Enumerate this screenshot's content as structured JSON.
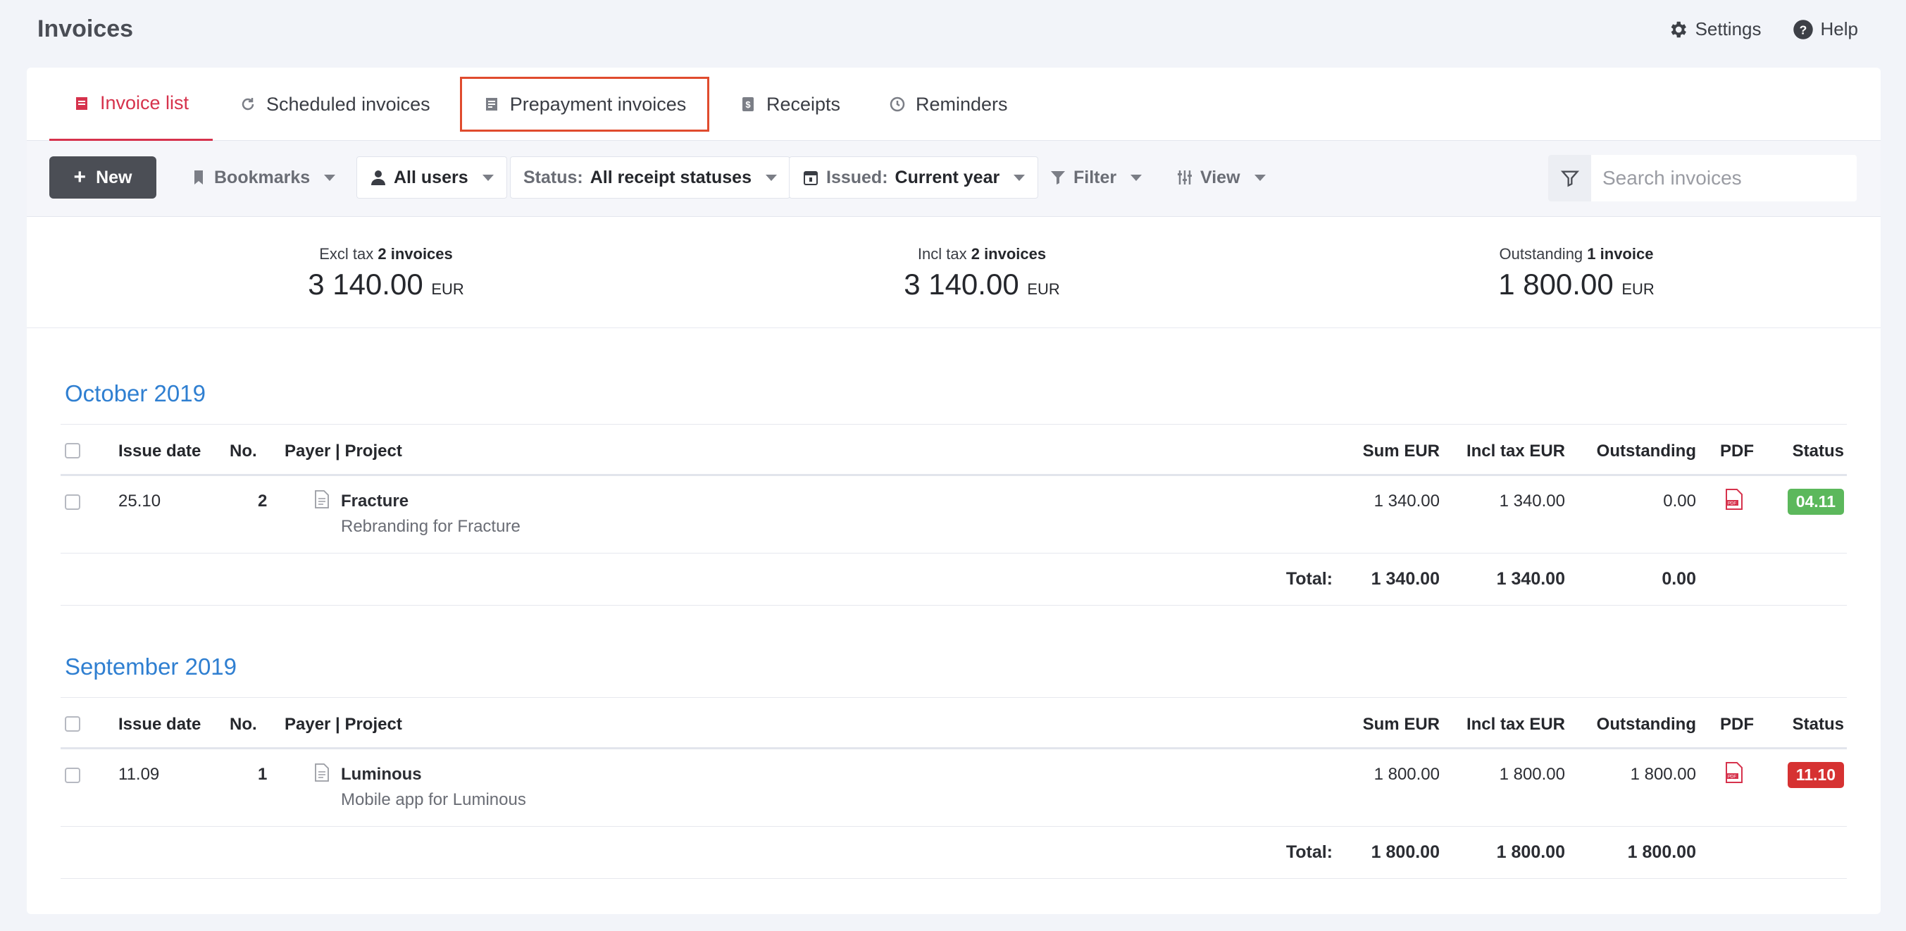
{
  "header": {
    "title": "Invoices",
    "settings_label": "Settings",
    "help_label": "Help"
  },
  "tabs": [
    {
      "label": "Invoice list",
      "icon": "invoice-icon",
      "active": true
    },
    {
      "label": "Scheduled invoices",
      "icon": "refresh-icon",
      "active": false
    },
    {
      "label": "Prepayment invoices",
      "icon": "prepayment-icon",
      "active": false,
      "highlighted": true
    },
    {
      "label": "Receipts",
      "icon": "receipt-icon",
      "active": false
    },
    {
      "label": "Reminders",
      "icon": "clock-icon",
      "active": false
    }
  ],
  "toolbar": {
    "new_label": "New",
    "bookmarks_label": "Bookmarks",
    "users_label": "All users",
    "status_prefix": "Status:",
    "status_value": "All receipt statuses",
    "issued_prefix": "Issued:",
    "issued_value": "Current year",
    "filter_label": "Filter",
    "view_label": "View",
    "search_placeholder": "Search invoices"
  },
  "summary": [
    {
      "label": "Excl tax",
      "count": "2 invoices",
      "value": "3 140.00",
      "currency": "EUR"
    },
    {
      "label": "Incl tax",
      "count": "2 invoices",
      "value": "3 140.00",
      "currency": "EUR"
    },
    {
      "label": "Outstanding",
      "count": "1 invoice",
      "value": "1 800.00",
      "currency": "EUR"
    }
  ],
  "columns": {
    "issue_date": "Issue date",
    "no": "No.",
    "payer": "Payer | Project",
    "sum": "Sum EUR",
    "incl": "Incl tax EUR",
    "outstanding": "Outstanding",
    "pdf": "PDF",
    "status": "Status"
  },
  "groups": [
    {
      "month": "October 2019",
      "rows": [
        {
          "date": "25.10",
          "no": "2",
          "payer": "Fracture",
          "project": "Rebranding for Fracture",
          "sum": "1 340.00",
          "incl": "1 340.00",
          "outstanding": "0.00",
          "status": "04.11",
          "status_color": "#5cb85c"
        }
      ],
      "total_label": "Total:",
      "total_sum": "1 340.00",
      "total_incl": "1 340.00",
      "total_outstanding": "0.00"
    },
    {
      "month": "September 2019",
      "rows": [
        {
          "date": "11.09",
          "no": "1",
          "payer": "Luminous",
          "project": "Mobile app for Luminous",
          "sum": "1 800.00",
          "incl": "1 800.00",
          "outstanding": "1 800.00",
          "status": "11.10",
          "status_color": "#d63232"
        }
      ],
      "total_label": "Total:",
      "total_sum": "1 800.00",
      "total_incl": "1 800.00",
      "total_outstanding": "1 800.00"
    }
  ],
  "colors": {
    "accent": "#d6324c",
    "month_blue": "#2f7fd1",
    "highlight_box": "#e04b2e"
  }
}
